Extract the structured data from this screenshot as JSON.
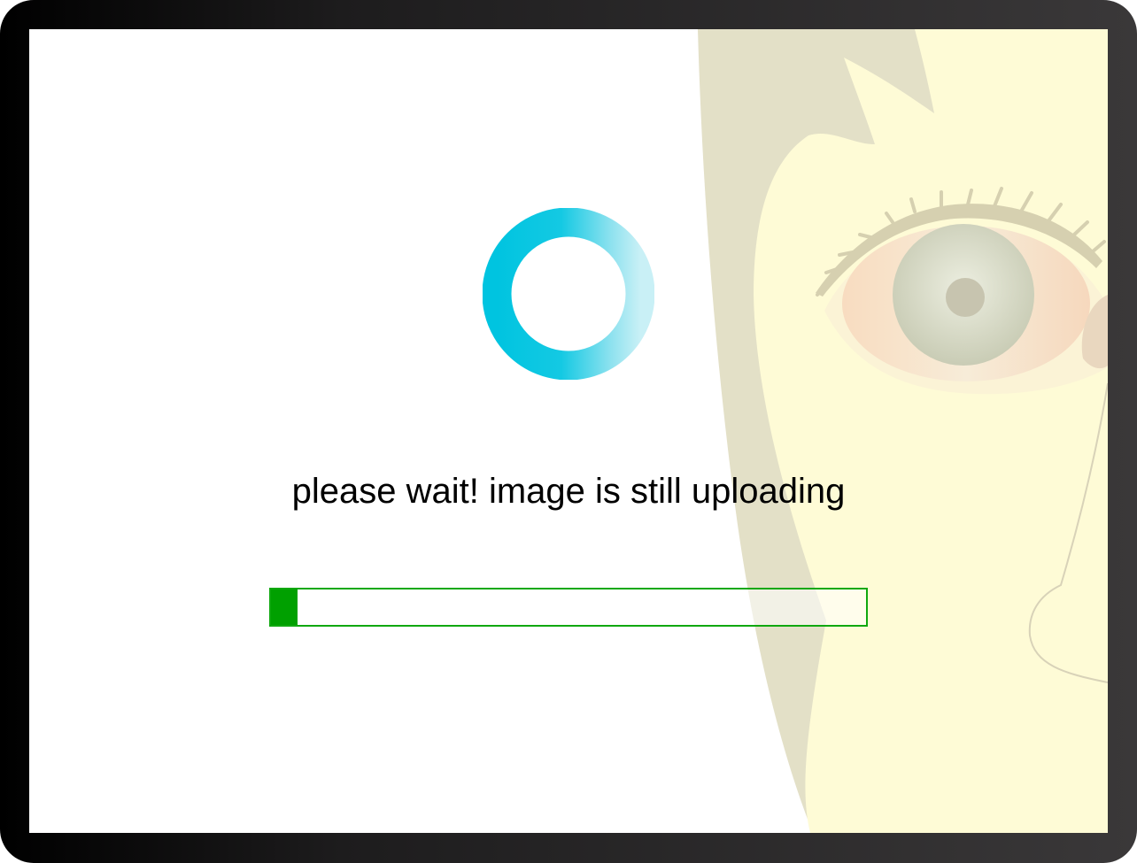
{
  "upload_status": {
    "message": "please wait! image is still uploading",
    "progress_percent": 4.5
  },
  "colors": {
    "spinner": "#00c4e0",
    "progress_fill": "#00a000",
    "progress_border": "#10a810",
    "frame": "#1d1c1d"
  },
  "icons": {
    "spinner": "loading-ring-icon"
  }
}
